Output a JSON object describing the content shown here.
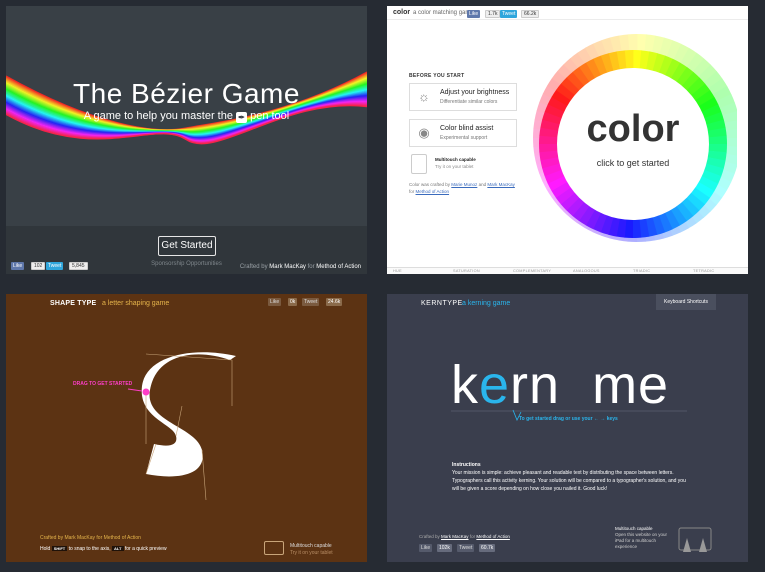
{
  "bezier": {
    "title": "The Bézier Game",
    "subtitle_pre": "A game to help you master the",
    "pen_icon": "pen-icon",
    "subtitle_post": "pen tool",
    "start_button": "Get Started",
    "sponsorship": "Sponsorship Opportunities",
    "crafted_pre": "Crafted by",
    "author": "Mark MacKay",
    "crafted_mid": "for",
    "org": "Method of Action",
    "like_label": "Like",
    "like_count": "102",
    "tweet_label": "Tweet",
    "tweet_count": "5,845"
  },
  "color": {
    "logo": "color",
    "tagline": "a color matching game",
    "like_label": "Like",
    "like_count": "1.7k",
    "tweet_label": "Tweet",
    "tweet_count": "66.2k",
    "before_start": "BEFORE YOU START",
    "cards": [
      {
        "title": "Adjust your brightness",
        "subtitle": "Differentiate similar colors",
        "icon": "brightness-icon"
      },
      {
        "title": "Color blind assist",
        "subtitle": "Experimental support",
        "icon": "eye-icon"
      }
    ],
    "multitouch_title": "Multitouch capable",
    "multitouch_sub": "Try it on your tablet",
    "credit_pre": "Color was crafted by",
    "credit_a": "Marie Munoz",
    "credit_and": "and",
    "credit_b": "Mark MacKay",
    "credit_for": "for",
    "credit_org": "Method of Action",
    "big_word": "color",
    "click_hint": "click to get started",
    "modes": [
      "HUE",
      "SATURATION",
      "COMPLEMENTARY",
      "ANALOGOUS",
      "TRIADIC",
      "TETRADIC"
    ],
    "accent": "#3a6bbd"
  },
  "shape": {
    "title": "SHAPE TYPE",
    "tagline": "a letter shaping game",
    "like_label": "Like",
    "like_count": "0k",
    "tweet_label": "Tweet",
    "tweet_count": "24.6k",
    "drag_hint": "DRAG TO GET STARTED",
    "crafted_pre": "Crafted by",
    "author": "Mark MacKay",
    "crafted_for": "for",
    "org": "Method of Action",
    "hold": "Hold",
    "shift_key": "SHIFT",
    "snap_text": "to snap to the axis,",
    "alt_key": "ALT",
    "preview_text": "for a quick preview",
    "multitouch_title": "Multitouch capable",
    "multitouch_sub": "Try it on your tablet",
    "accent": "#e5b44b",
    "handle_color": "#ff3ec8"
  },
  "kern": {
    "title": "KERNTYPE",
    "tagline": "a kerning game",
    "shortcuts_button": "Keyboard Shortcuts",
    "word_k": "k",
    "word_e": "e",
    "word_rest": "rn  me",
    "hint": "To get started drag or use your ← → keys",
    "instructions_title": "Instructions",
    "instructions_body": "Your mission is simple: achieve pleasant and readable text by distributing the space between letters. Typographers call this activity kerning. Your solution will be compared to a typographer's solution, and you will be given a score depending on how close you nailed it. Good luck!",
    "crafted_pre": "Crafted by",
    "author": "Mark MacKay",
    "crafted_for": "for",
    "org": "Method of Action",
    "multitouch_title": "Multitouch capable",
    "multitouch_sub": "Open this website on your iPad for a multitouch experience",
    "like_label": "Like",
    "like_count": "102k",
    "tweet_label": "Tweet",
    "tweet_count": "60.7k",
    "accent": "#2ab5ec"
  }
}
